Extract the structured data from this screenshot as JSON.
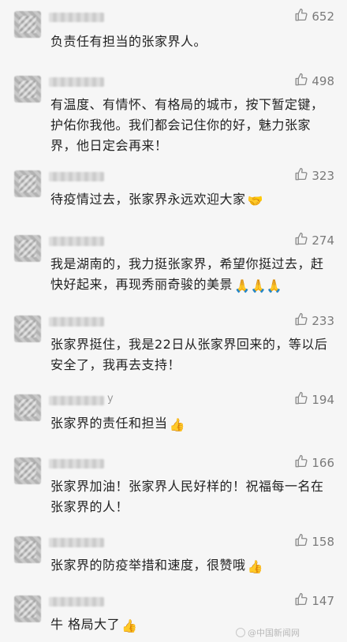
{
  "comments": [
    {
      "likes": "652",
      "text": "负责任有担当的张家界人。",
      "emoji": ""
    },
    {
      "likes": "498",
      "text": "有温度、有情怀、有格局的城市，按下暂定键，护佑你我他。我们都会记住你的好，魅力张家界，他日定会再来！",
      "emoji": ""
    },
    {
      "likes": "323",
      "text": "待疫情过去，张家界永远欢迎大家",
      "emoji": "🤝"
    },
    {
      "likes": "274",
      "text": "我是湖南的，我力挺张家界，希望你挺过去，赶快好起来，再现秀丽奇骏的美景",
      "emoji": "🙏🙏🙏"
    },
    {
      "likes": "233",
      "text": "张家界挺住，我是22日从张家界回来的，等以后安全了，我再去支持！",
      "emoji": ""
    },
    {
      "likes": "194",
      "text": "张家界的责任和担当",
      "emoji": "👍",
      "name_tail": "y"
    },
    {
      "likes": "166",
      "text": "张家界加油！张家界人民好样的！祝福每一名在张家界的人！",
      "emoji": ""
    },
    {
      "likes": "158",
      "text": "张家界的防疫举措和速度，很赞哦",
      "emoji": "👍"
    },
    {
      "likes": "147",
      "text": "牛 格局大了",
      "emoji": "👍"
    }
  ],
  "watermark": "@中国新闻网",
  "icons": {
    "like": "thumbs-up-icon"
  }
}
